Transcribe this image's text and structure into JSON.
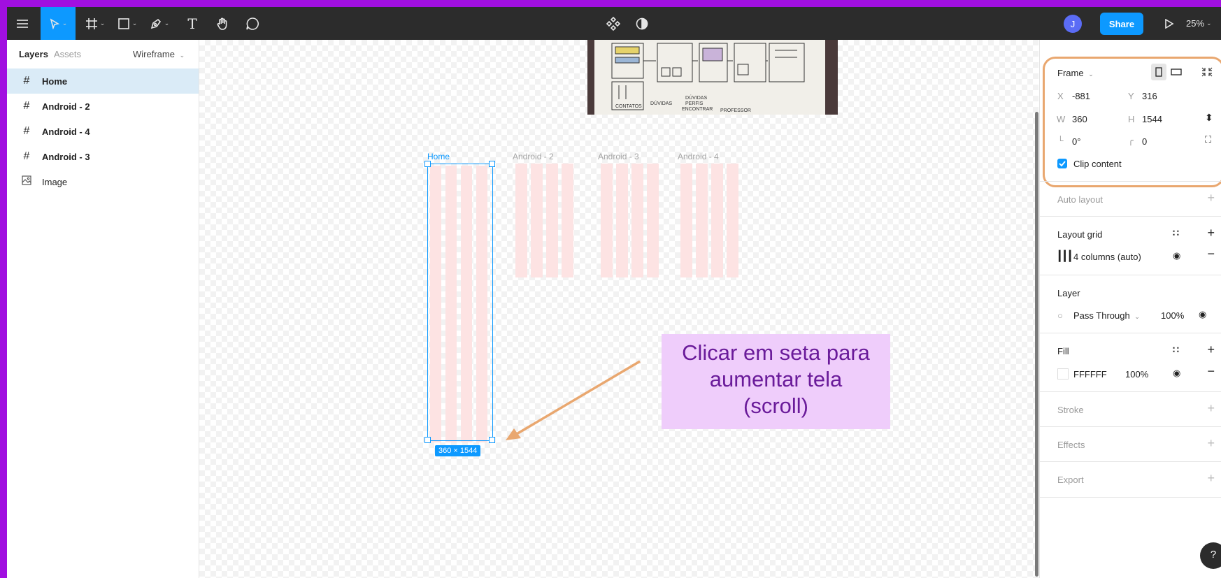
{
  "toolbar": {
    "zoom": "25%",
    "avatar_initial": "J",
    "share_label": "Share"
  },
  "left_panel": {
    "tabs": [
      "Layers",
      "Assets"
    ],
    "page": "Wireframe",
    "layers": [
      {
        "label": "Home",
        "icon": "frame-icon",
        "selected": true
      },
      {
        "label": "Android - 2",
        "icon": "frame-icon",
        "selected": false
      },
      {
        "label": "Android - 4",
        "icon": "frame-icon",
        "selected": false
      },
      {
        "label": "Android - 3",
        "icon": "frame-icon",
        "selected": false
      },
      {
        "label": "Image",
        "icon": "image-icon",
        "selected": false
      }
    ]
  },
  "canvas": {
    "frames": [
      "Home",
      "Android - 2",
      "Android - 3",
      "Android - 4"
    ],
    "selection_size": "360 × 1544",
    "annotation": {
      "line1": "Clicar em seta para",
      "line2": "aumentar tela",
      "line3": "(scroll)"
    },
    "sketch_words": [
      "CONTATOS",
      "DÚVIDAS",
      "DÚVIDAS",
      "PERFIS",
      "ENCONTRAR",
      "PROFESSOR"
    ]
  },
  "right_panel": {
    "frame": {
      "title": "Frame",
      "x_label": "X",
      "x": "-881",
      "y_label": "Y",
      "y": "316",
      "w_label": "W",
      "w": "360",
      "h_label": "H",
      "h": "1544",
      "rotation": "0°",
      "radius": "0",
      "clip_label": "Clip content"
    },
    "auto_layout": "Auto layout",
    "layout_grid": {
      "title": "Layout grid",
      "item": "4 columns (auto)"
    },
    "layer": {
      "title": "Layer",
      "blend": "Pass Through",
      "opacity": "100%"
    },
    "fill": {
      "title": "Fill",
      "color": "FFFFFF",
      "opacity": "100%"
    },
    "stroke": "Stroke",
    "effects": "Effects",
    "export": "Export",
    "help": "?"
  },
  "colors": {
    "accent": "#0d99ff",
    "outer_border": "#a10fe0",
    "annotation_bg": "#efcdfb",
    "annotation_text": "#6a1b9a",
    "arrow": "#e9a76f",
    "grid_column": "#fde3e3"
  }
}
